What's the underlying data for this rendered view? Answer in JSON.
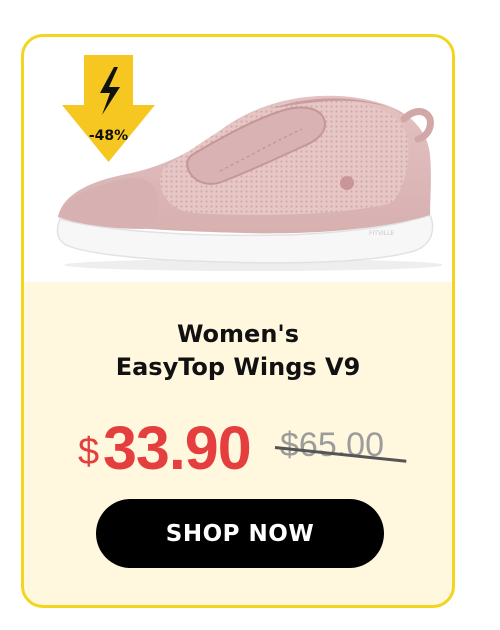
{
  "badge": {
    "icon": "lightning-bolt-icon",
    "label": "-48%",
    "color": "#f6c721"
  },
  "product": {
    "title_line1": "Women's",
    "title_line2": "EasyTop Wings V9",
    "image": "pink-velcro-sneaker-image"
  },
  "pricing": {
    "currency": "$",
    "price": "33.90",
    "original_price": "$65.00",
    "price_color": "#e43e3e"
  },
  "cta": {
    "label": "SHOP NOW"
  },
  "colors": {
    "border": "#f4d51e",
    "card_background": "#fff8df",
    "button": "#000000"
  }
}
